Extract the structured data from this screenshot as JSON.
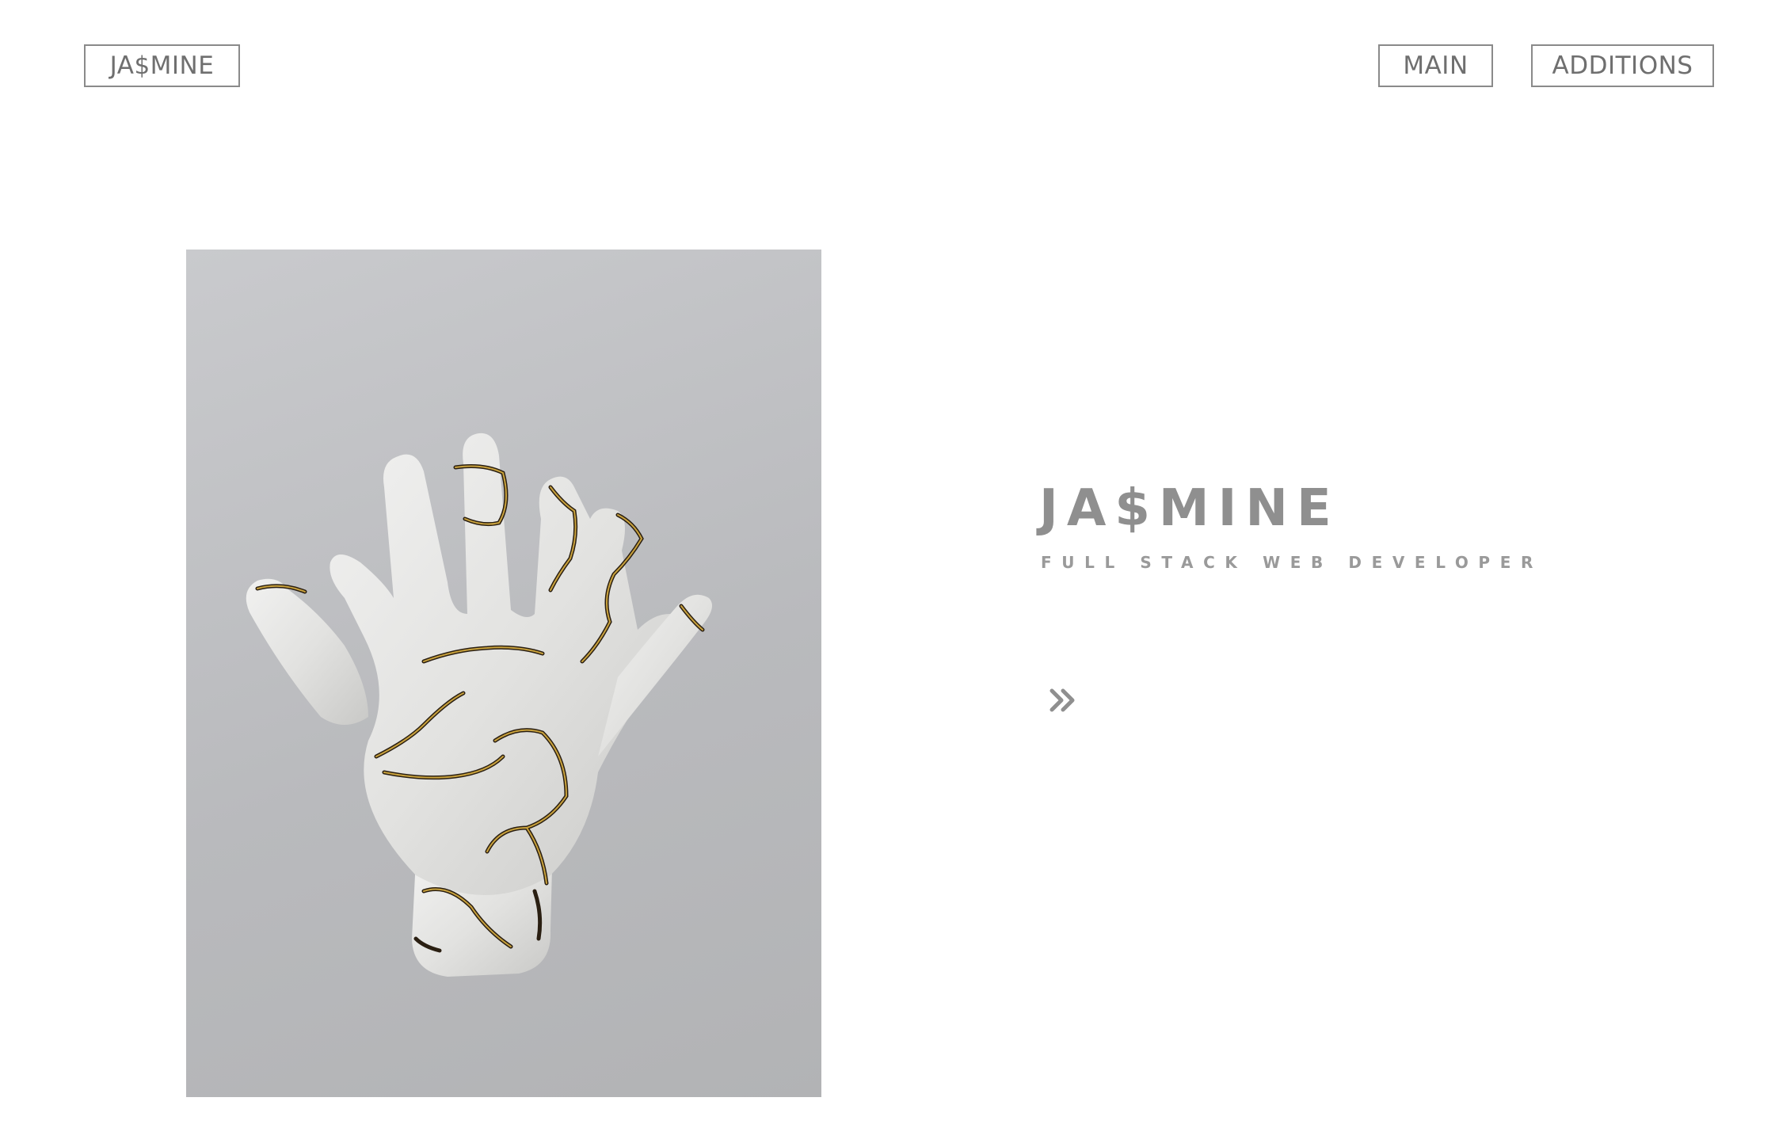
{
  "header": {
    "brand_label": "JA$MINE",
    "nav": {
      "main_label": "MAIN",
      "additions_label": "ADDITIONS"
    }
  },
  "hero": {
    "image_icon": "cracked-marble-hand-sculpture",
    "title": "JA$MINE",
    "subtitle": "FULL STACK WEB DEVELOPER",
    "next_icon": "double-chevron-right-icon"
  },
  "colors": {
    "text_gray": "#8f8f8f",
    "border_gray": "#8a8a8a",
    "image_bg": "#b9babd",
    "gold_crack": "#b8902a",
    "background": "#ffffff"
  }
}
